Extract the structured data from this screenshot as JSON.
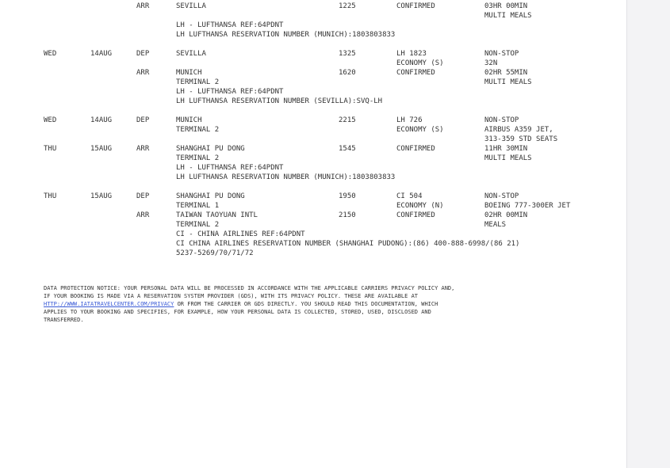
{
  "segments": [
    {
      "arr": {
        "type": "ARR",
        "city": "SEVILLA",
        "time": "1225",
        "status": "CONFIRMED",
        "info": [
          "03HR 00MIN",
          "MULTI MEALS"
        ]
      },
      "notes": [
        "LH - LUFTHANSA REF:64PDNT",
        "LH LUFTHANSA RESERVATION NUMBER (MUNICH):1803803833"
      ]
    },
    {
      "day": "WED",
      "date": "14AUG",
      "dep": {
        "type": "DEP",
        "city": "SEVILLA",
        "time": "1325",
        "flight": "LH 1823",
        "class": "ECONOMY (S)",
        "info": [
          "NON-STOP",
          "32N"
        ]
      },
      "arr": {
        "type": "ARR",
        "city": "MUNICH",
        "terminal": "TERMINAL 2",
        "time": "1620",
        "status": "CONFIRMED",
        "info": [
          "02HR 55MIN",
          "MULTI MEALS"
        ]
      },
      "notes": [
        "LH - LUFTHANSA REF:64PDNT",
        "LH LUFTHANSA RESERVATION NUMBER (SEVILLA):SVQ-LH"
      ]
    },
    {
      "dep_day": "WED",
      "dep_date": "14AUG",
      "dep": {
        "type": "DEP",
        "city": "MUNICH",
        "terminal": "TERMINAL 2",
        "time": "2215",
        "flight": "LH 726",
        "class": "ECONOMY (S)",
        "info": [
          "NON-STOP",
          "AIRBUS A359 JET,",
          "313-359 STD SEATS"
        ]
      },
      "arr_day": "THU",
      "arr_date": "15AUG",
      "arr": {
        "type": "ARR",
        "city": "SHANGHAI PU DONG",
        "terminal": "TERMINAL 2",
        "time": "1545",
        "status": "CONFIRMED",
        "info": [
          "11HR 30MIN",
          "MULTI MEALS"
        ]
      },
      "notes": [
        "LH - LUFTHANSA REF:64PDNT",
        "LH LUFTHANSA RESERVATION NUMBER (MUNICH):1803803833"
      ]
    },
    {
      "day": "THU",
      "date": "15AUG",
      "dep": {
        "type": "DEP",
        "city": "SHANGHAI PU DONG",
        "terminal": "TERMINAL 1",
        "time": "1950",
        "flight": "CI 504",
        "class": "ECONOMY (N)",
        "info": [
          "NON-STOP",
          "BOEING 777-300ER JET"
        ]
      },
      "arr": {
        "type": "ARR",
        "city": "TAIWAN TAOYUAN INTL",
        "terminal": "TERMINAL 2",
        "time": "2150",
        "status": "CONFIRMED",
        "info": [
          "02HR 00MIN",
          "MEALS"
        ]
      },
      "notes": [
        "CI - CHINA AIRLINES REF:64PDNT",
        "CI CHINA AIRLINES RESERVATION NUMBER (SHANGHAI PUDONG):(86) 400-888-6998/(86 21)",
        "5237-5269/70/71/72"
      ]
    }
  ],
  "notice": {
    "line1": "DATA PROTECTION NOTICE: YOUR PERSONAL DATA WILL BE PROCESSED IN ACCORDANCE WITH THE APPLICABLE CARRIERS PRIVACY POLICY AND,",
    "line2": "IF YOUR BOOKING IS MADE VIA A RESERVATION SYSTEM PROVIDER (GDS), WITH ITS PRIVACY POLICY. THESE ARE AVAILABLE AT",
    "link": "HTTP://WWW.IATATRAVELCENTER.COM/PRIVACY",
    "line3_rest": " OR FROM THE CARRIER OR GDS DIRECTLY. YOU SHOULD READ THIS DOCUMENTATION, WHICH",
    "line4": "APPLIES TO YOUR BOOKING AND SPECIFIES, FOR EXAMPLE, HOW YOUR PERSONAL DATA IS COLLECTED, STORED, USED, DISCLOSED AND",
    "line5": "TRANSFERRED."
  },
  "colors": {
    "text": "#333333",
    "link": "#3b5bd6",
    "side_panel": "#f3f3f5"
  }
}
